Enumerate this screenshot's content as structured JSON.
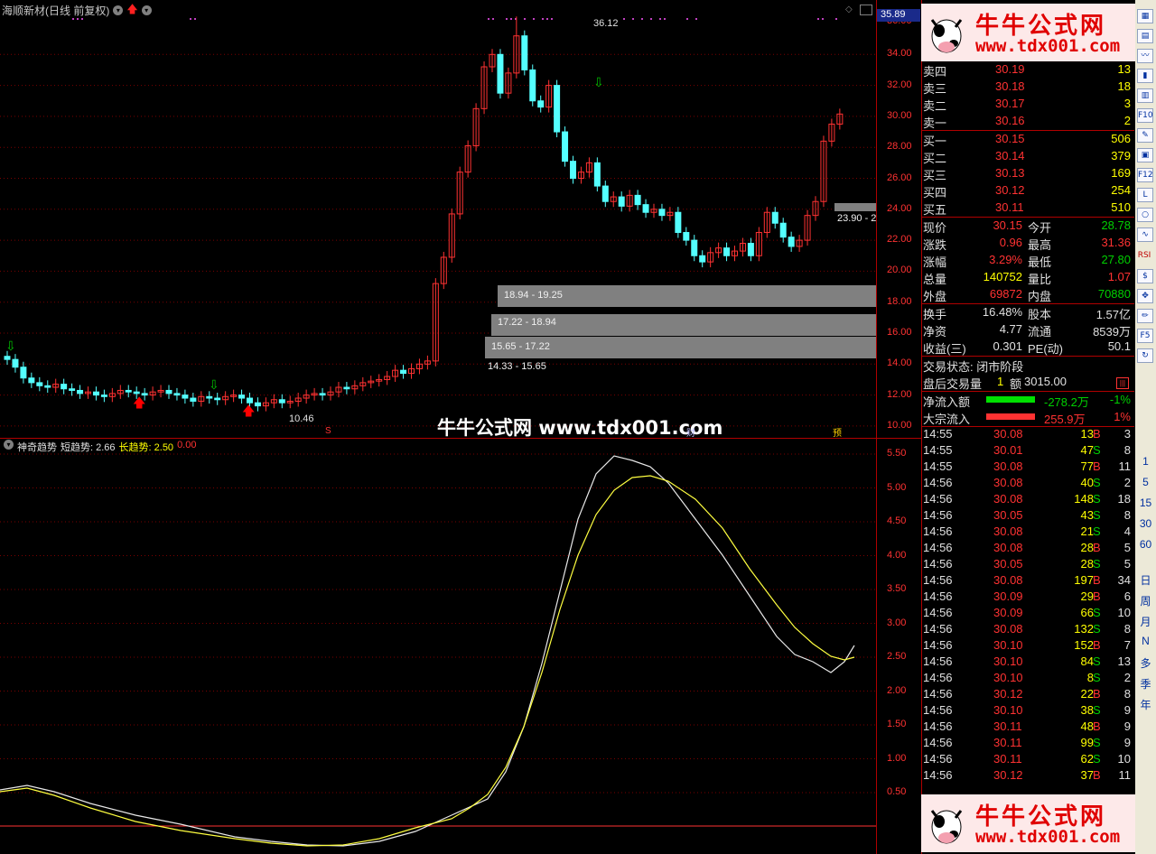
{
  "main_chart": {
    "title": "海顺新材(日线 前复权)",
    "current_price_tag": "35.89",
    "price_ticks": [
      "34.00",
      "32.00",
      "30.00",
      "28.00",
      "26.00",
      "24.00",
      "22.00",
      "20.00",
      "18.00",
      "16.00",
      "14.00",
      "12.00",
      "10.00"
    ],
    "price_tick_values": [
      34,
      32,
      30,
      28,
      26,
      24,
      22,
      20,
      18,
      16,
      14,
      12,
      10
    ],
    "top_tick": "36.00",
    "annotations": {
      "high": "36.12",
      "low": "10.46"
    },
    "chip_bands": [
      {
        "label": "18.94 - 19.25",
        "price": 19.1
      },
      {
        "label": "17.22 - 18.94",
        "price": 18.1
      },
      {
        "label": "15.65 - 17.22",
        "price": 16.4
      },
      {
        "label": "14.33 - 15.65",
        "price": 15.0
      },
      {
        "label": "23.90 - 2",
        "price": 24.1
      }
    ],
    "bottom_markers": [
      "S",
      "财",
      "预"
    ],
    "colors": {
      "up": "#ff3232",
      "down": "#54ffff",
      "grid": "#7a0000",
      "arrow_up": "#ff0000",
      "arrow_down": "#00c000"
    }
  },
  "indicator": {
    "name": "神奇趋势",
    "short_label": "短趋势: 2.66",
    "long_label": "长趋势: 2.50",
    "extra_label": "0.00",
    "ticks": [
      "5.50",
      "5.00",
      "4.50",
      "4.00",
      "3.50",
      "3.00",
      "2.50",
      "2.00",
      "1.50",
      "1.00",
      "0.50"
    ],
    "tick_values": [
      5.5,
      5.0,
      4.5,
      4.0,
      3.5,
      3.0,
      2.5,
      2.0,
      1.5,
      1.0,
      0.5
    ]
  },
  "watermark": "牛牛公式网 www.tdx001.com",
  "logo": {
    "line1": "牛牛公式网",
    "line2": "www.tdx001.com"
  },
  "order_book": {
    "asks": [
      {
        "label": "卖四",
        "price": "30.19",
        "vol": "13"
      },
      {
        "label": "卖三",
        "price": "30.18",
        "vol": "18"
      },
      {
        "label": "卖二",
        "price": "30.17",
        "vol": "3"
      },
      {
        "label": "卖一",
        "price": "30.16",
        "vol": "2"
      }
    ],
    "bids": [
      {
        "label": "买一",
        "price": "30.15",
        "vol": "506"
      },
      {
        "label": "买二",
        "price": "30.14",
        "vol": "379"
      },
      {
        "label": "买三",
        "price": "30.13",
        "vol": "169"
      },
      {
        "label": "买四",
        "price": "30.12",
        "vol": "254"
      },
      {
        "label": "买五",
        "price": "30.11",
        "vol": "510"
      }
    ]
  },
  "quote": [
    {
      "l1": "现价",
      "v1": "30.15",
      "l2": "今开",
      "v2": "28.78"
    },
    {
      "l1": "涨跌",
      "v1": "0.96",
      "l2": "最高",
      "v2": "31.36"
    },
    {
      "l1": "涨幅",
      "v1": "3.29%",
      "l2": "最低",
      "v2": "27.80"
    },
    {
      "l1": "总量",
      "v1": "140752",
      "l2": "量比",
      "v2": "1.07"
    },
    {
      "l1": "外盘",
      "v1": "69872",
      "l2": "内盘",
      "v2": "70880"
    }
  ],
  "stats": [
    {
      "l1": "换手",
      "v1": "16.48%",
      "l2": "股本",
      "v2": "1.57亿"
    },
    {
      "l1": "净资",
      "v1": "4.77",
      "l2": "流通",
      "v2": "8539万"
    },
    {
      "l1": "收益(三)",
      "v1": "0.301",
      "l2": "PE(动)",
      "v2": "50.1"
    }
  ],
  "trade_status": "交易状态: 闭市阶段",
  "after_hours": {
    "label": "盘后交易量",
    "vol": "1",
    "amt_label": "额",
    "amt": "3015.00"
  },
  "flows": [
    {
      "label": "净流入额",
      "value": "-278.2万",
      "pct": "-1%",
      "bar_color": "#00e000"
    },
    {
      "label": "大宗流入",
      "value": "255.9万",
      "pct": "1%",
      "bar_color": "#ff3232"
    }
  ],
  "ticks": [
    {
      "time": "14:55",
      "price": "30.08",
      "vol": "13",
      "side": "B",
      "n": "3"
    },
    {
      "time": "14:55",
      "price": "30.01",
      "vol": "47",
      "side": "S",
      "n": "8"
    },
    {
      "time": "14:55",
      "price": "30.08",
      "vol": "77",
      "side": "B",
      "n": "11"
    },
    {
      "time": "14:56",
      "price": "30.08",
      "vol": "40",
      "side": "S",
      "n": "2"
    },
    {
      "time": "14:56",
      "price": "30.08",
      "vol": "148",
      "side": "S",
      "n": "18"
    },
    {
      "time": "14:56",
      "price": "30.05",
      "vol": "43",
      "side": "S",
      "n": "8"
    },
    {
      "time": "14:56",
      "price": "30.08",
      "vol": "21",
      "side": "S",
      "n": "4"
    },
    {
      "time": "14:56",
      "price": "30.08",
      "vol": "28",
      "side": "B",
      "n": "5"
    },
    {
      "time": "14:56",
      "price": "30.05",
      "vol": "28",
      "side": "S",
      "n": "5"
    },
    {
      "time": "14:56",
      "price": "30.08",
      "vol": "197",
      "side": "B",
      "n": "34"
    },
    {
      "time": "14:56",
      "price": "30.09",
      "vol": "29",
      "side": "B",
      "n": "6"
    },
    {
      "time": "14:56",
      "price": "30.09",
      "vol": "66",
      "side": "S",
      "n": "10"
    },
    {
      "time": "14:56",
      "price": "30.08",
      "vol": "132",
      "side": "S",
      "n": "8"
    },
    {
      "time": "14:56",
      "price": "30.10",
      "vol": "152",
      "side": "B",
      "n": "7"
    },
    {
      "time": "14:56",
      "price": "30.10",
      "vol": "84",
      "side": "S",
      "n": "13"
    },
    {
      "time": "14:56",
      "price": "30.10",
      "vol": "8",
      "side": "S",
      "n": "2"
    },
    {
      "time": "14:56",
      "price": "30.12",
      "vol": "22",
      "side": "B",
      "n": "8"
    },
    {
      "time": "14:56",
      "price": "30.10",
      "vol": "38",
      "side": "S",
      "n": "9"
    },
    {
      "time": "14:56",
      "price": "30.11",
      "vol": "48",
      "side": "B",
      "n": "9"
    },
    {
      "time": "14:56",
      "price": "30.11",
      "vol": "99",
      "side": "S",
      "n": "9"
    },
    {
      "time": "14:56",
      "price": "30.11",
      "vol": "62",
      "side": "S",
      "n": "10"
    },
    {
      "time": "14:56",
      "price": "30.12",
      "vol": "37",
      "side": "B",
      "n": "11"
    }
  ],
  "toolbar": {
    "periods": [
      "1",
      "5",
      "15",
      "30",
      "60",
      "日",
      "周",
      "月",
      "N",
      "多",
      "季",
      "年"
    ],
    "icon_labels": [
      "F10",
      "F12",
      "RSI",
      "F5"
    ]
  }
}
